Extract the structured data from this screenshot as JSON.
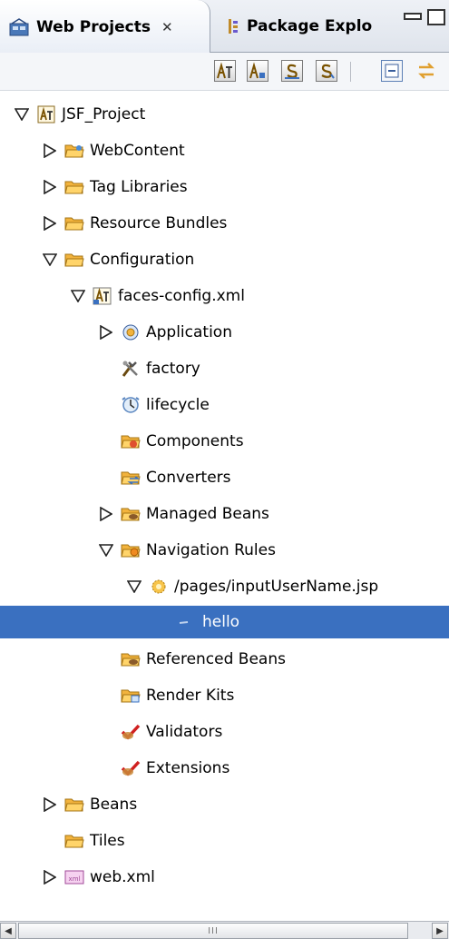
{
  "tabs": {
    "active": {
      "label": "Web Projects",
      "close": "✕"
    },
    "inactive": {
      "label": "Package Explo"
    }
  },
  "toolbar": {
    "icons": [
      "project-icon-1",
      "project-icon-2",
      "s-icon-1",
      "s-icon-2",
      "collapse-all-icon",
      "link-with-editor-icon"
    ]
  },
  "tree": [
    {
      "label": "JSF_Project",
      "depth": 0,
      "state": "open",
      "icon": "jsf-project-icon"
    },
    {
      "label": "WebContent",
      "depth": 1,
      "state": "closed",
      "icon": "webcontent-folder-icon"
    },
    {
      "label": "Tag Libraries",
      "depth": 1,
      "state": "closed",
      "icon": "folder-icon"
    },
    {
      "label": "Resource Bundles",
      "depth": 1,
      "state": "closed",
      "icon": "folder-icon"
    },
    {
      "label": "Configuration",
      "depth": 1,
      "state": "open",
      "icon": "folder-icon"
    },
    {
      "label": "faces-config.xml",
      "depth": 2,
      "state": "open",
      "icon": "faces-config-icon"
    },
    {
      "label": "Application",
      "depth": 3,
      "state": "closed",
      "icon": "application-icon"
    },
    {
      "label": "factory",
      "depth": 3,
      "state": "none",
      "icon": "factory-icon"
    },
    {
      "label": "lifecycle",
      "depth": 3,
      "state": "none",
      "icon": "lifecycle-icon"
    },
    {
      "label": "Components",
      "depth": 3,
      "state": "none",
      "icon": "components-folder-icon"
    },
    {
      "label": "Converters",
      "depth": 3,
      "state": "none",
      "icon": "converters-folder-icon"
    },
    {
      "label": "Managed Beans",
      "depth": 3,
      "state": "closed",
      "icon": "beans-folder-icon"
    },
    {
      "label": "Navigation Rules",
      "depth": 3,
      "state": "open",
      "icon": "navigation-folder-icon"
    },
    {
      "label": "/pages/inputUserName.jsp",
      "depth": 4,
      "state": "open",
      "icon": "navigation-rule-icon"
    },
    {
      "label": "hello",
      "depth": 5,
      "state": "none",
      "icon": "navigation-case-icon",
      "selected": true
    },
    {
      "label": "Referenced Beans",
      "depth": 3,
      "state": "none",
      "icon": "beans-folder-icon"
    },
    {
      "label": "Render Kits",
      "depth": 3,
      "state": "none",
      "icon": "renderkit-folder-icon"
    },
    {
      "label": "Validators",
      "depth": 3,
      "state": "none",
      "icon": "validators-check-icon"
    },
    {
      "label": "Extensions",
      "depth": 3,
      "state": "none",
      "icon": "validators-check-icon"
    },
    {
      "label": "Beans",
      "depth": 1,
      "state": "closed",
      "icon": "folder-icon"
    },
    {
      "label": "Tiles",
      "depth": 1,
      "state": "none",
      "icon": "folder-icon"
    },
    {
      "label": "web.xml",
      "depth": 1,
      "state": "closed",
      "icon": "web-xml-icon"
    }
  ],
  "scrollbar": {
    "thumb_grip": "III"
  },
  "colors": {
    "selection": "#3a70c0",
    "folder": "#f2b33d"
  }
}
